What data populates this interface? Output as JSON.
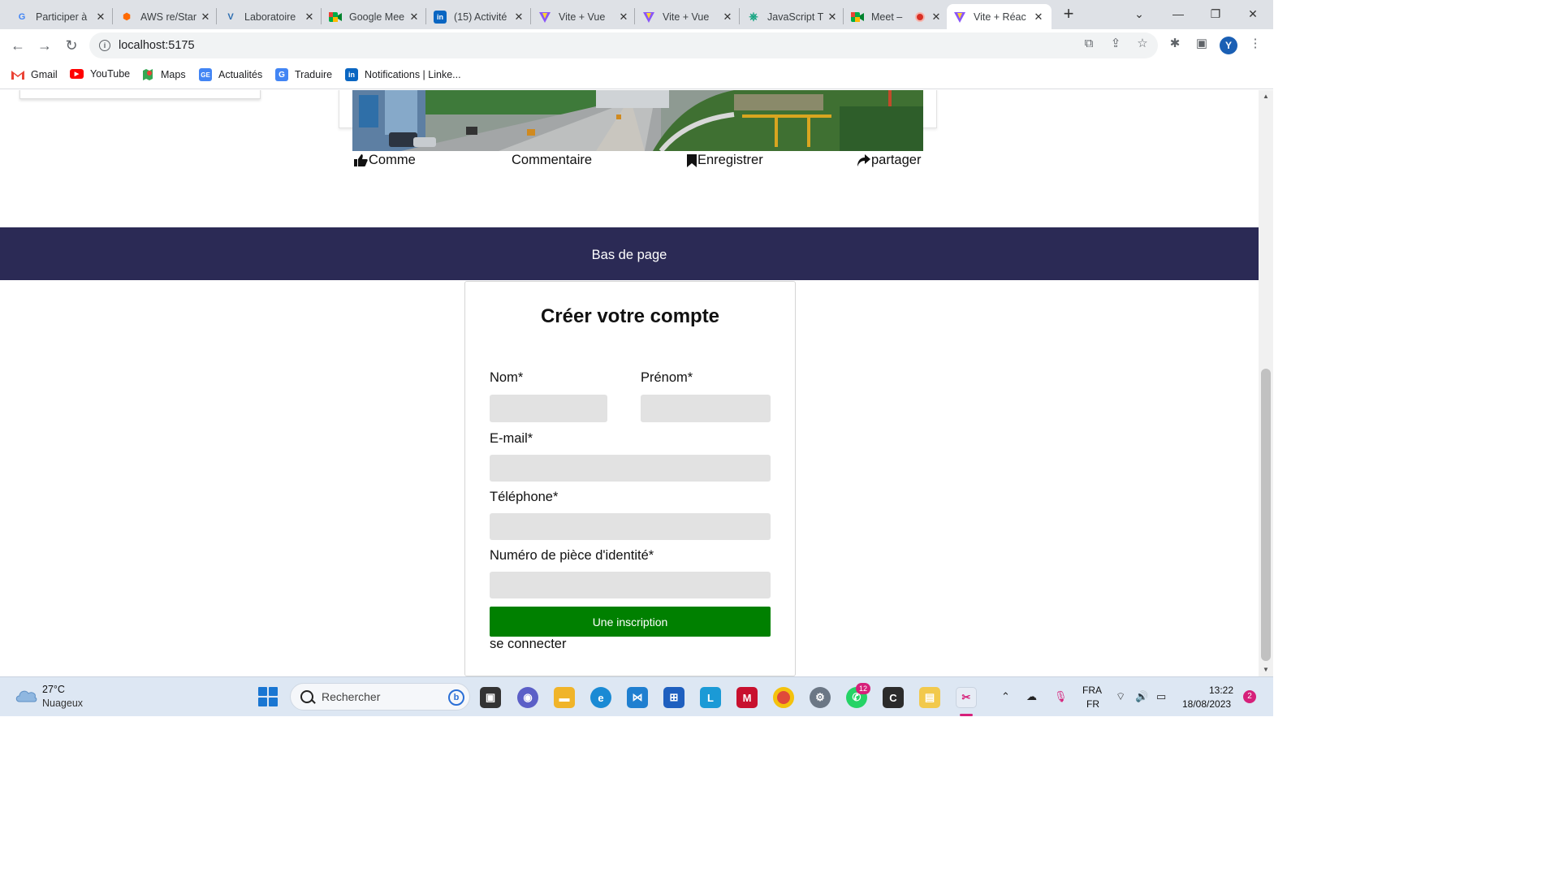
{
  "browser": {
    "tabs": [
      {
        "title": "Participer à",
        "icon": "google-icon",
        "color": "#4285f4"
      },
      {
        "title": "AWS re/Star",
        "icon": "aws-icon",
        "color": "#ff6a00"
      },
      {
        "title": "Laboratoire",
        "icon": "vite-icon",
        "color": "#2b6cb0"
      },
      {
        "title": "Google Mee",
        "icon": "meet-icon",
        "color": "#00897b"
      },
      {
        "title": "(15) Activité",
        "icon": "linkedin-icon",
        "color": "#0a66c2"
      },
      {
        "title": "Vite + Vue",
        "icon": "vite-icon",
        "color": "#8a55f7"
      },
      {
        "title": "Vite + Vue",
        "icon": "vite-icon",
        "color": "#8a55f7"
      },
      {
        "title": "JavaScript T",
        "icon": "chatgpt-icon",
        "color": "#10a37f"
      },
      {
        "title": "Meet –",
        "icon": "meet-icon",
        "color": "#00897b"
      },
      {
        "title": "Vite + Réac",
        "icon": "vite-icon",
        "color": "#8a55f7"
      }
    ],
    "active_tab_index": 9,
    "new_tab_label": "+",
    "url": "localhost:5175",
    "profile_initial": "Y",
    "bookmarks": [
      {
        "label": "Gmail",
        "icon": "gmail-icon",
        "color": "#ea4335"
      },
      {
        "label": "YouTube",
        "icon": "youtube-icon",
        "color": "#ff0000"
      },
      {
        "label": "Maps",
        "icon": "maps-icon",
        "color": "#34a853"
      },
      {
        "label": "Actualités",
        "icon": "news-icon",
        "color": "#4285f4"
      },
      {
        "label": "Traduire",
        "icon": "translate-icon",
        "color": "#4285f4"
      },
      {
        "label": "Notifications | Linke...",
        "icon": "linkedin-icon",
        "color": "#0a66c2"
      }
    ]
  },
  "post": {
    "actions": {
      "like": "Comme",
      "comment": "Commentaire",
      "save": "Enregistrer",
      "share": "partager"
    }
  },
  "footer": {
    "text": "Bas de page",
    "background": "#2b2a55"
  },
  "signup_form": {
    "title": "Créer votre compte",
    "last_name_label": "Nom*",
    "first_name_label": "Prénom*",
    "email_label": "E-mail*",
    "phone_label": "Téléphone*",
    "id_number_label": "Numéro de pièce d'identité*",
    "submit_label": "Une inscription",
    "submit_color": "#008000",
    "login_link": "se connecter",
    "values": {
      "last_name": "",
      "first_name": "",
      "email": "",
      "phone": "",
      "id_number": ""
    }
  },
  "taskbar": {
    "weather_temp": "27°C",
    "weather_desc": "Nuageux",
    "search_placeholder": "Rechercher",
    "whatsapp_badge": "12",
    "lang_line1": "FRA",
    "lang_line2": "FR",
    "time": "13:22",
    "date": "18/08/2023",
    "notification_count": "2"
  }
}
